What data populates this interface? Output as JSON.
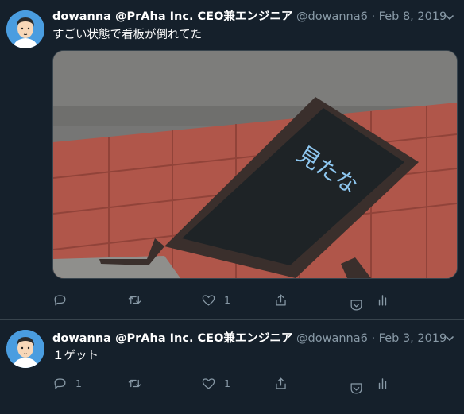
{
  "tweets": [
    {
      "author_name": "dowanna @PrAha Inc. CEO兼エンジニア",
      "handle": "@dowanna6",
      "separator": "·",
      "date": "Feb 8, 2019",
      "text": "すごい状態で看板が倒れてた",
      "photo": {
        "board_text": "見たな"
      },
      "actions": {
        "reply_count": "",
        "retweet_count": "",
        "like_count": "1"
      }
    },
    {
      "author_name": "dowanna @PrAha Inc. CEO兼エンジニア",
      "handle": "@dowanna6",
      "separator": "·",
      "date": "Feb 3, 2019",
      "text": "１ゲット",
      "actions": {
        "reply_count": "1",
        "retweet_count": "",
        "like_count": "1"
      }
    }
  ],
  "colors": {
    "background": "#15202b",
    "text": "#ffffff",
    "secondary_text": "#8899a6",
    "divider": "#38444d",
    "avatar_bg": "#4a9de0"
  },
  "icons": [
    "avatar-illustration",
    "reply-icon",
    "retweet-icon",
    "like-icon",
    "share-icon",
    "bookmark-icon",
    "stats-icon",
    "chevron-down-icon"
  ]
}
